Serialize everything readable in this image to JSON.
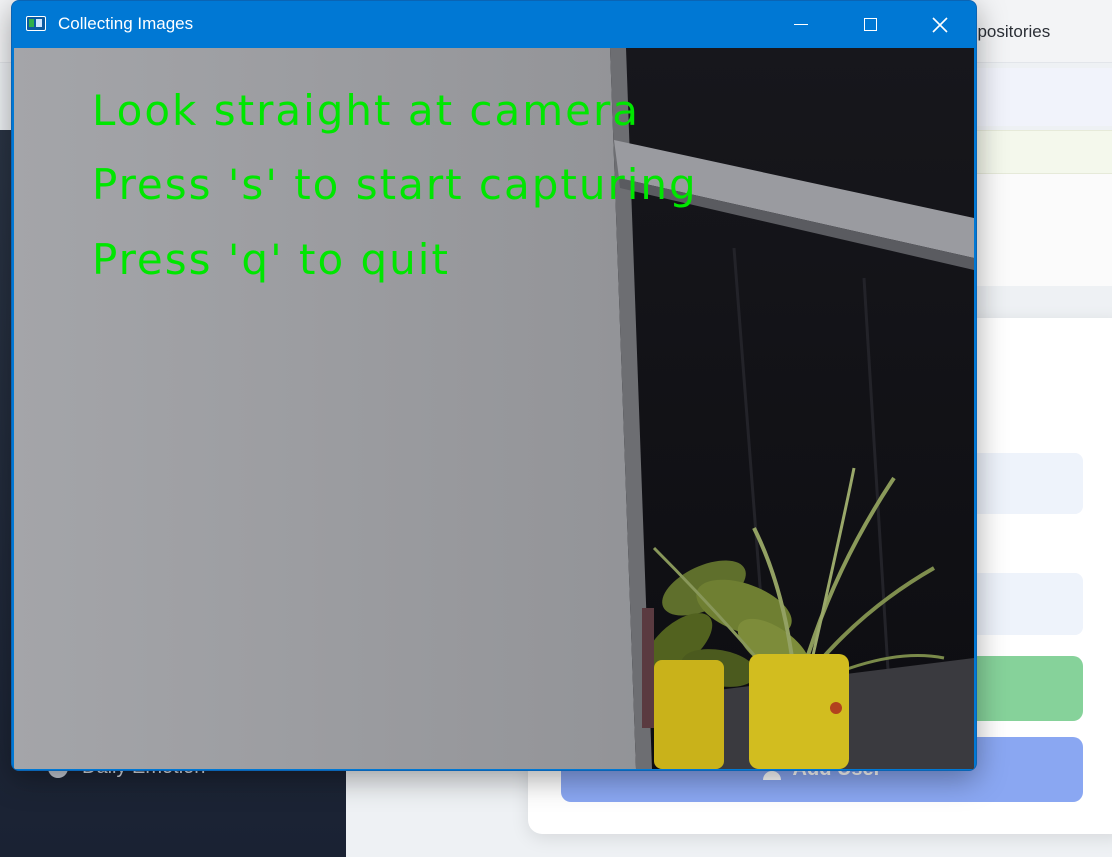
{
  "background": {
    "header_tab_label": "epositories",
    "sidebar_item_label": "Daily Emotion",
    "add_user_button_label": "Add User"
  },
  "window": {
    "title": "Collecting Images",
    "controls": {
      "minimize": "minimize-icon",
      "maximize": "maximize-icon",
      "close": "close-icon"
    }
  },
  "camera_overlay": {
    "line1": "Look straight at camera",
    "line2": "Press 's' to start capturing",
    "line3": "Press 'q' to quit",
    "text_color": "#00e600"
  },
  "colors": {
    "titlebar": "#0078d4",
    "sidebar": "#1f2a3b",
    "green_button": "#86d29a",
    "blue_button": "#8aa7f2"
  }
}
